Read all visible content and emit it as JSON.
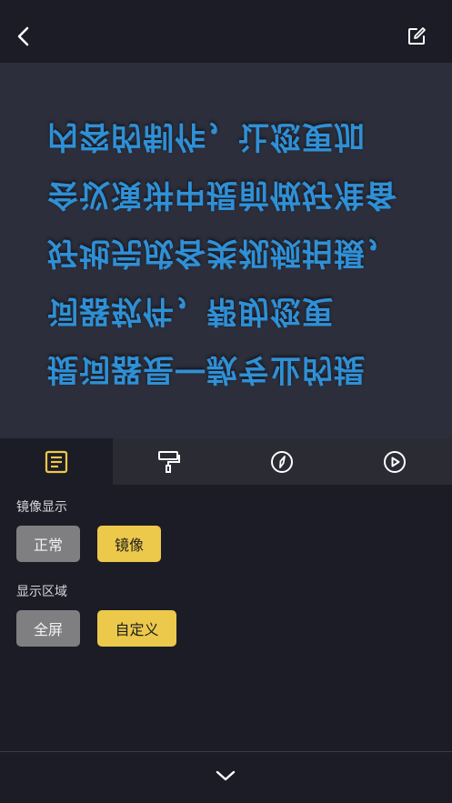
{
  "header": {
    "back_icon": "chevron-left-icon",
    "edit_icon": "edit-icon"
  },
  "preview": {
    "text_color": "#2f90d6",
    "background": "#2c2e3b",
    "lines": [
      "提词器是一款专业的提",
      "词器软件，帮助您更",
      "好地完成各类视频拍摄，",
      "会议演讲中提前做好准备",
      "内容的制作，让您更加"
    ]
  },
  "tabs": [
    {
      "icon": "text-icon",
      "active": true
    },
    {
      "icon": "paint-roller-icon",
      "active": false
    },
    {
      "icon": "compass-icon",
      "active": false
    },
    {
      "icon": "play-circle-icon",
      "active": false
    }
  ],
  "settings": {
    "mirror": {
      "label": "镜像显示",
      "options": [
        "正常",
        "镜像"
      ],
      "selected": "镜像"
    },
    "area": {
      "label": "显示区域",
      "options": [
        "全屏",
        "自定义"
      ],
      "selected": "自定义"
    }
  },
  "footer": {
    "collapse_icon": "chevron-down-icon"
  },
  "colors": {
    "accent": "#ecc94b",
    "inactive_button": "#7f7f82",
    "background": "#1c1c26"
  }
}
